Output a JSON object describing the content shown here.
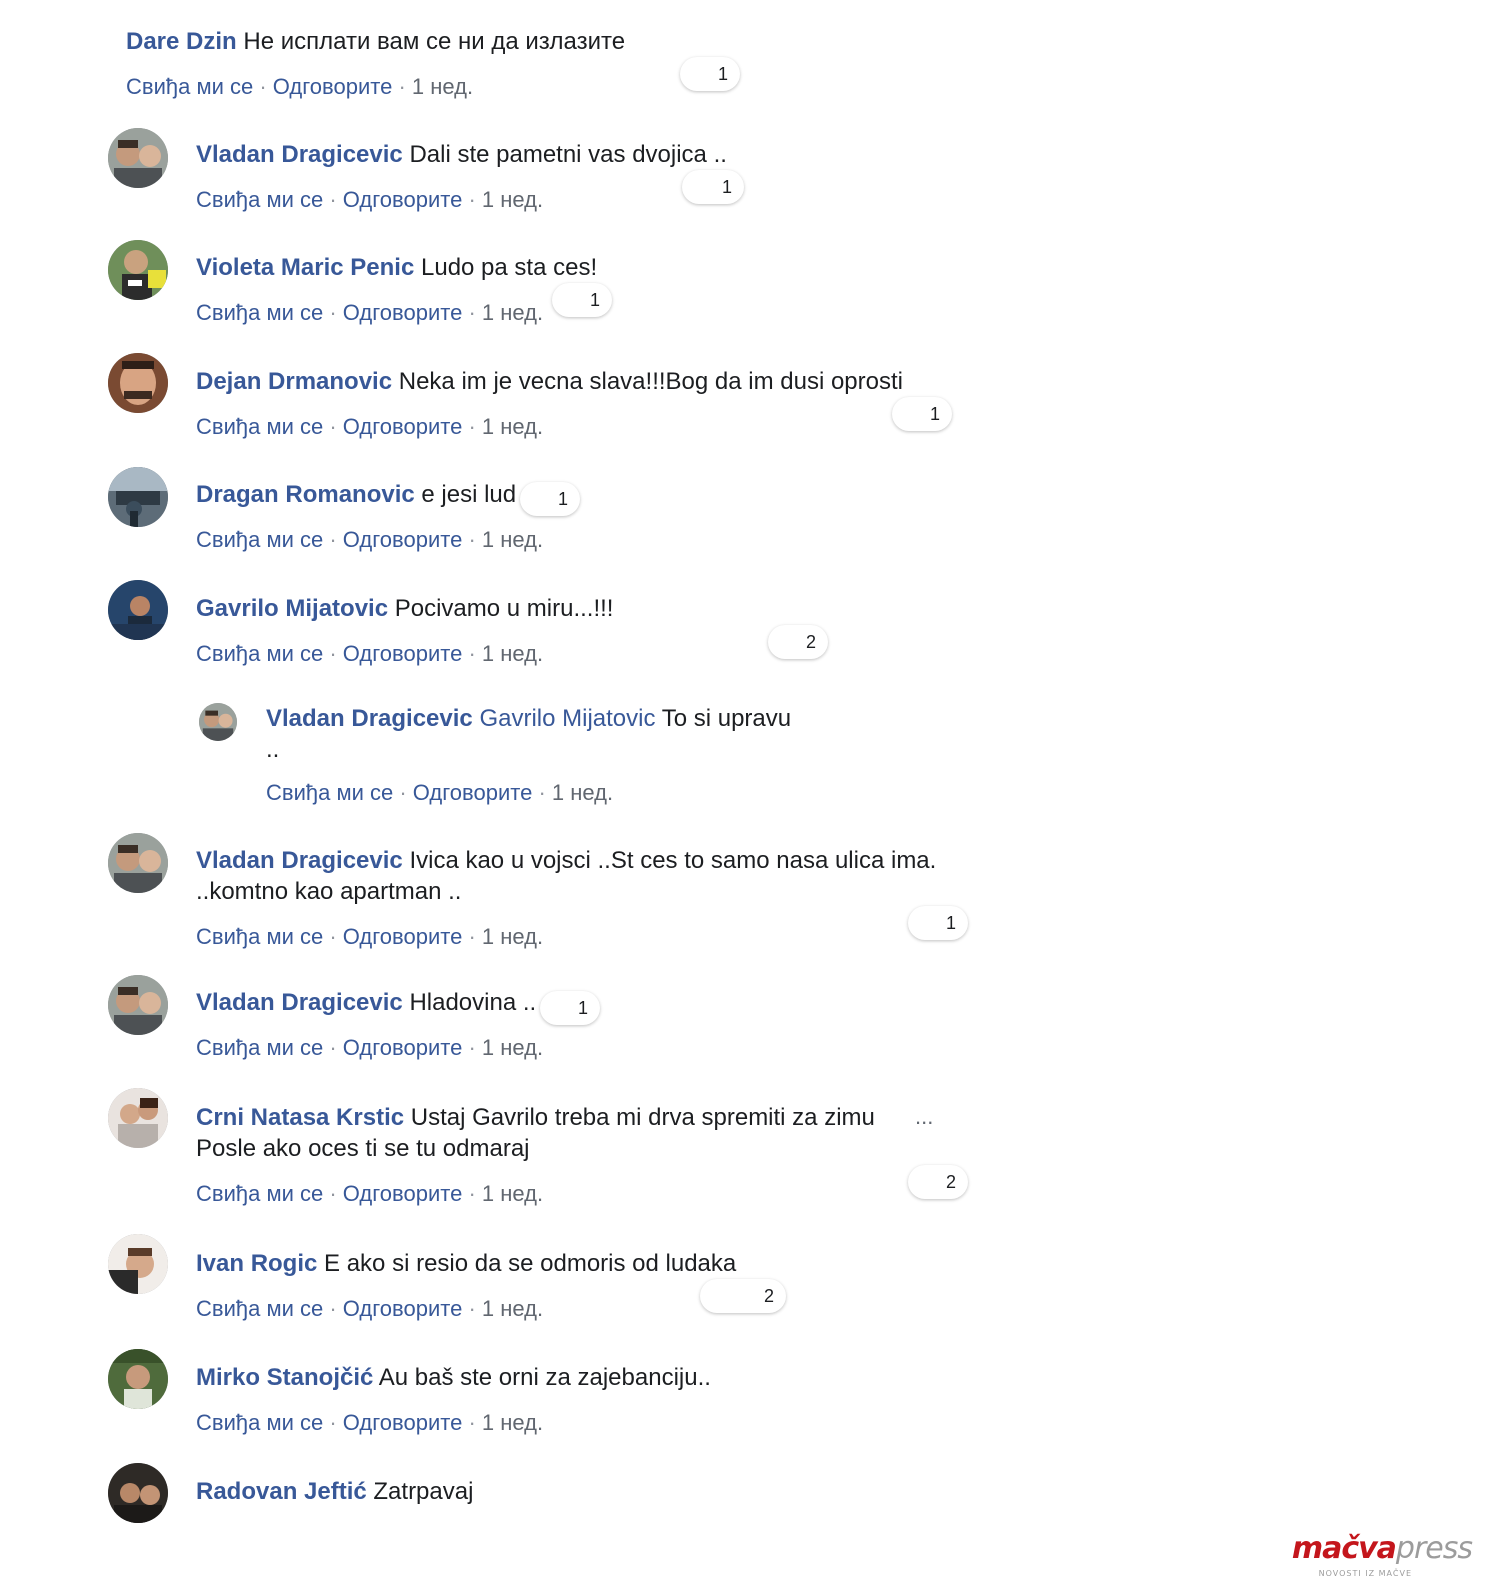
{
  "actions": {
    "like": "Свиђа ми се",
    "reply": "Одговорите",
    "sep": "·",
    "time": "1 нед."
  },
  "comments": [
    {
      "author": "Dare Dzin",
      "text": "Не исплати вам се ни да излазите",
      "reactions": "1"
    },
    {
      "author": "Vladan Dragicevic",
      "text": "Dali ste pametni vas dvojica ..",
      "reactions": "1"
    },
    {
      "author": "Violeta Maric Penic",
      "text": "Ludo pa sta ces!",
      "reactions": "1"
    },
    {
      "author": "Dejan Drmanovic",
      "text": "Neka im je vecna slava!!!Bog da im dusi oprosti",
      "reactions": "1"
    },
    {
      "author": "Dragan Romanovic",
      "text": "e jesi lud",
      "reactions": "1"
    },
    {
      "author": "Gavrilo Mijatovic",
      "text": "Pocivamo u miru...!!!",
      "reactions": "2"
    },
    {
      "author": "Vladan Dragicevic",
      "mention": "Gavrilo Mijatovic",
      "text": "To si upravu",
      "text2": ".."
    },
    {
      "author": "Vladan Dragicevic",
      "text": "Ivica kao u vojsci ..St ces to samo nasa ulica ima.",
      "text2": "..komtno kao apartman ..",
      "reactions": "1"
    },
    {
      "author": "Vladan Dragicevic",
      "text": "Hladovina ..",
      "reactions": "1"
    },
    {
      "author": "Crni Natasa Krstic",
      "text": "Ustaj Gavrilo treba mi drva spremiti za zimu",
      "text2": "Posle ako oces ti se tu odmaraj",
      "reactions": "2",
      "more": "..."
    },
    {
      "author": "Ivan Rogic",
      "text": "E ako si resio da se odmoris od ludaka",
      "reactions": "2"
    },
    {
      "author": "Mirko Stanojčić",
      "text": "Au baš ste orni za zajebanciju.."
    },
    {
      "author": "Radovan Jeftić",
      "text": "Zatrpavaj"
    }
  ],
  "logo": {
    "part1": "mačva",
    "part2": "press",
    "tagline": "NOVOSTI IZ MAČVE"
  }
}
